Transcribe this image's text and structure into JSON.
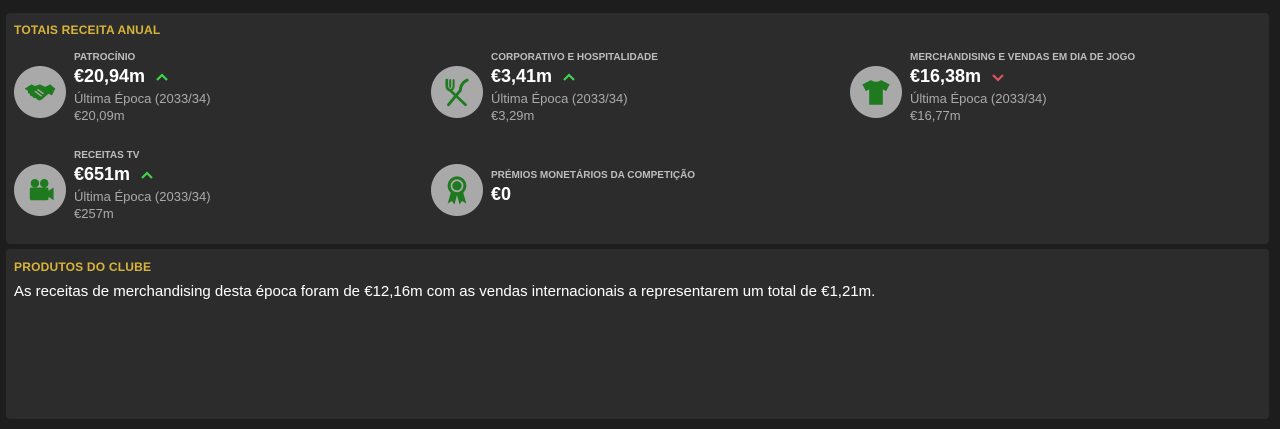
{
  "totals": {
    "title": "TOTAIS RECEITA ANUAL",
    "title_color": "#d8b43a",
    "up_color": "#3fd34d",
    "down_color": "#e0525a",
    "icon_color": "#1f7a1f",
    "items": [
      {
        "label": "PATROCÍNIO",
        "value": "€20,94m",
        "trend": "up",
        "icon": "handshake-icon",
        "last_season": "Última Época (2033/34)",
        "last_value": "€20,09m"
      },
      {
        "label": "CORPORATIVO E HOSPITALIDADE",
        "value": "€3,41m",
        "trend": "up",
        "icon": "fork-knife-icon",
        "last_season": "Última Época (2033/34)",
        "last_value": "€3,29m"
      },
      {
        "label": "MERCHANDISING E VENDAS EM DIA DE JOGO",
        "value": "€16,38m",
        "trend": "down",
        "icon": "shirt-icon",
        "last_season": "Última Época (2033/34)",
        "last_value": "€16,77m"
      },
      {
        "label": "RECEITAS TV",
        "value": "€651m",
        "trend": "up",
        "icon": "video-camera-icon",
        "last_season": "Última Época (2033/34)",
        "last_value": "€257m"
      },
      {
        "label": "PRÉMIOS MONETÁRIOS DA COMPETIÇÃO",
        "value": "€0",
        "trend": "none",
        "icon": "award-ribbon-icon"
      }
    ]
  },
  "products": {
    "title": "PRODUTOS DO CLUBE",
    "description": "As receitas de merchandising desta época foram de €12,16m com as vendas internacionais a representarem um total de €1,21m."
  }
}
